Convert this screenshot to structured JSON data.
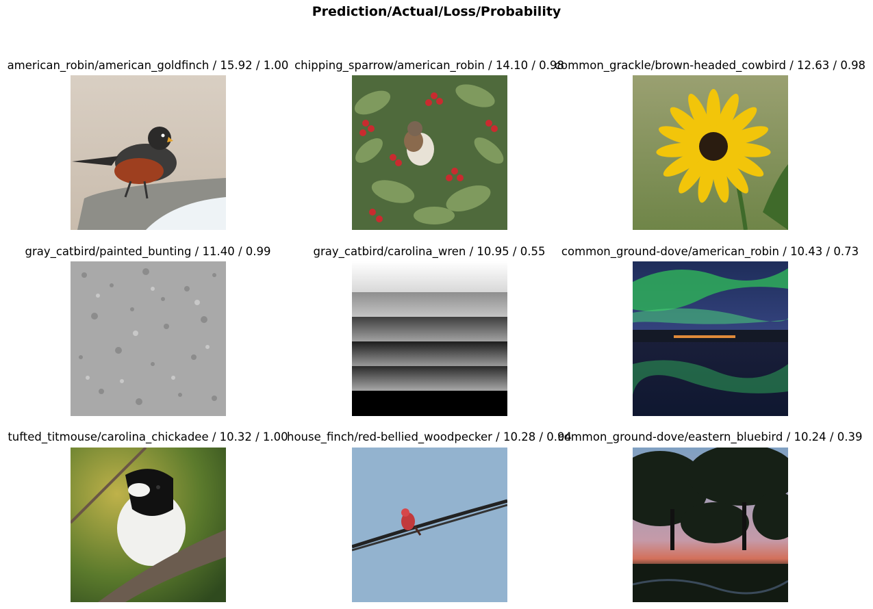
{
  "figure": {
    "suptitle": "Prediction/Actual/Loss/Probability"
  },
  "panels": [
    {
      "title": "american_robin/american_goldfinch / 15.92 / 1.00",
      "image": "robin-on-birdbath-photo"
    },
    {
      "title": "chipping_sparrow/american_robin / 14.10 / 0.98",
      "image": "sparrow-in-berry-bush-photo"
    },
    {
      "title": "common_grackle/brown-headed_cowbird / 12.63 / 0.98",
      "image": "yellow-sunflower-photo"
    },
    {
      "title": "gray_catbird/painted_bunting / 11.40 / 0.99",
      "image": "gray-stucco-texture-photo"
    },
    {
      "title": "gray_catbird/carolina_wren / 10.95 / 0.55",
      "image": "gray-gradient-bands-image"
    },
    {
      "title": "common_ground-dove/american_robin / 10.43 / 0.73",
      "image": "aurora-over-lake-photo"
    },
    {
      "title": "tufted_titmouse/carolina_chickadee / 10.32 / 1.00",
      "image": "chickadee-on-branch-photo"
    },
    {
      "title": "house_finch/red-bellied_woodpecker / 10.28 / 0.94",
      "image": "red-finch-on-wire-photo"
    },
    {
      "title": "common_ground-dove/eastern_bluebird / 10.24 / 0.39",
      "image": "trees-at-sunset-photo"
    }
  ]
}
